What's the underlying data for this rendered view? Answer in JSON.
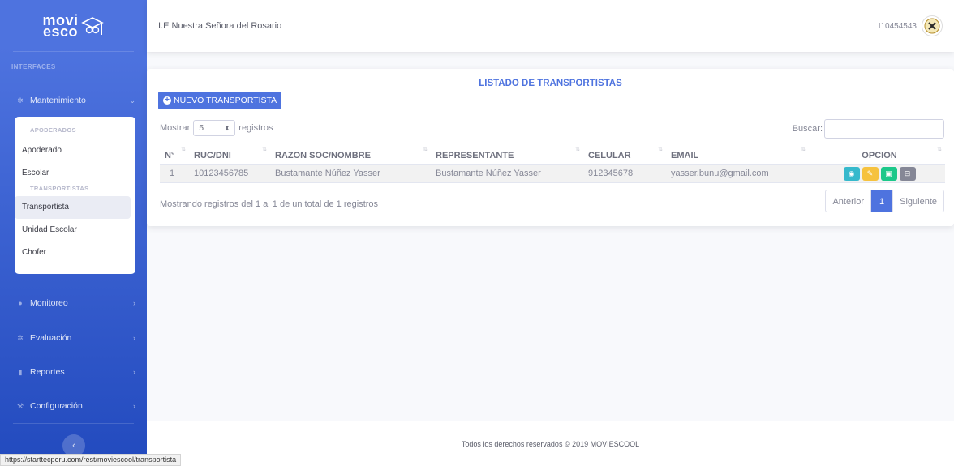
{
  "sidebar": {
    "brand_line1": "movi",
    "brand_line2": "esco",
    "section": "INTERFACES",
    "items": [
      {
        "label": "Mantenimiento",
        "icon": "gear-icon"
      },
      {
        "label": "Monitoreo",
        "icon": "map-pin-icon"
      },
      {
        "label": "Evaluación",
        "icon": "gear-icon"
      },
      {
        "label": "Reportes",
        "icon": "file-icon"
      },
      {
        "label": "Configuración",
        "icon": "wrench-icon"
      }
    ],
    "submenu": {
      "group1": "APODERADOS",
      "group1_items": [
        "Apoderado",
        "Escolar"
      ],
      "group2": "TRANSPORTISTAS",
      "group2_items": [
        "Transportista",
        "Unidad Escolar",
        "Chofer"
      ]
    },
    "toggle": "‹"
  },
  "topbar": {
    "title": "I.E Nuestra Señora del Rosario",
    "user": "I10454543"
  },
  "card": {
    "title": "LISTADO DE TRANSPORTISTAS",
    "new_button": "NUEVO TRANSPORTISTA",
    "show_label": "Mostrar",
    "show_value": "5",
    "records_label": "registros",
    "search_label": "Buscar:",
    "search_value": "",
    "columns": [
      "N°",
      "RUC/DNI",
      "RAZON SOC/NOMBRE",
      "REPRESENTANTE",
      "CELULAR",
      "EMAIL",
      "OPCION"
    ],
    "rows": [
      {
        "n": "1",
        "ruc": "10123456785",
        "razon": "Bustamante Núñez Yasser",
        "representante": "Bustamante Núñez Yasser",
        "celular": "912345678",
        "email": "yasser.bunu@gmail.com"
      }
    ],
    "info": "Mostrando registros del 1 al 1 de un total de 1 registros",
    "pager": {
      "prev": "Anterior",
      "current": "1",
      "next": "Siguiente"
    }
  },
  "footer": "Todos los derechos reservados © 2019 MOVIESCOOL",
  "status_url": "https://starttecperu.com/rest/moviescool/transportista",
  "colors": {
    "primary": "#4e73df",
    "info": "#36b9cc",
    "warning": "#f6c23e",
    "success": "#1cc88a",
    "secondary": "#858796"
  }
}
